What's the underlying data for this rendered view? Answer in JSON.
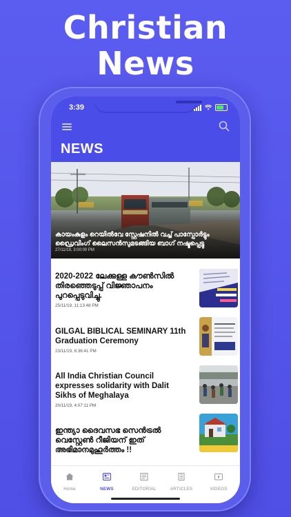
{
  "promo": {
    "line1": "Christian",
    "line2": "News"
  },
  "status_bar": {
    "time": "3:39"
  },
  "header": {
    "title": "NEWS",
    "menu_icon": "hamburger-menu-icon",
    "search_icon": "search-icon"
  },
  "hero": {
    "headline": "കായംകുളം റെയിൽവേ സ്റ്റേഷനിൽ വച്ച് പാസ്പോർട്ടും ഡ്രൈവിംഗ് ലൈസൻസുമടങ്ങിയ ബാഗ് നഷ്ടപ്പെട്ടു",
    "date": "27/11/19, 3:00:00 PM"
  },
  "articles": [
    {
      "title": "2020-2022 ലേക്കുള്ള കൗൺസിൽ തിരഞ്ഞെടുപ്പ് വിജ്ഞാപനം പുറപ്പെടുവിച്ചു.",
      "date": "25/11/19, 11:13:48 PM"
    },
    {
      "title": "GILGAL BIBLICAL SEMINARY 11th Graduation Ceremony",
      "date": "23/11/19, 6:36:41 PM"
    },
    {
      "title": "All India Christian Council expresses solidarity with Dalit Sikhs of Meghalaya",
      "date": "20/11/19, 4:07:11 PM"
    },
    {
      "title": "ഇന്ത്യാ ദൈവസഭ സെൻട്രൽ വെസ്റ്റേൺ റീജിയന് ഇത് അഭിമാനമുഹൂർത്തം !!",
      "date": "16/11/19, 4:48:40 PM"
    }
  ],
  "tabs": [
    {
      "label": "Home",
      "icon": "home-icon",
      "active": false
    },
    {
      "label": "NEWS",
      "icon": "news-icon",
      "active": true
    },
    {
      "label": "EDITORIAL",
      "icon": "editorial-icon",
      "active": false
    },
    {
      "label": "ARTICLES",
      "icon": "articles-icon",
      "active": false
    },
    {
      "label": "VIDEOS",
      "icon": "videos-icon",
      "active": false
    }
  ],
  "colors": {
    "brand": "#4b4de8",
    "background": "#5b5cf0",
    "active_tab": "#4b4de8",
    "inactive_tab": "#8a8a95"
  }
}
